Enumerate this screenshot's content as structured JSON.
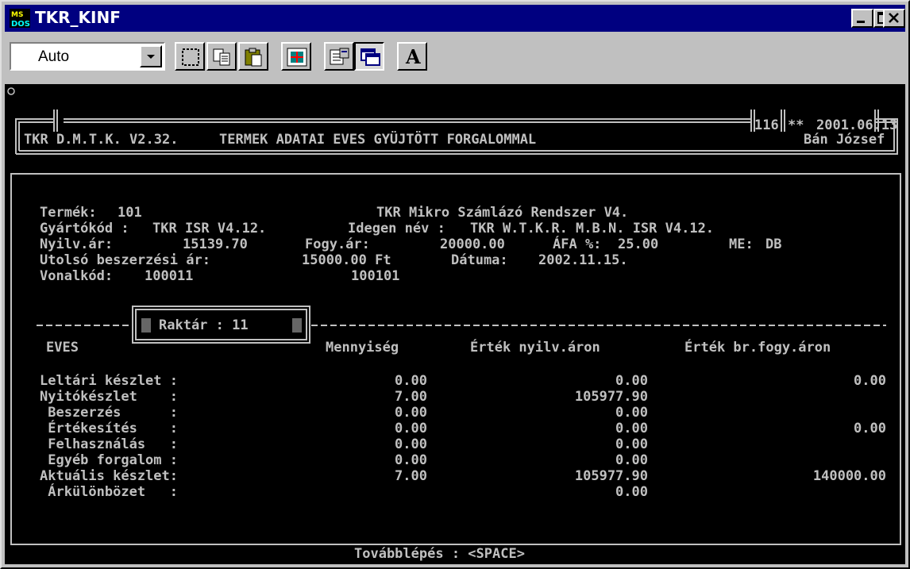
{
  "window": {
    "title": "TKR_KINF",
    "app_icon": "ms-dos-icon",
    "controls": [
      "minimize",
      "maximize",
      "close"
    ]
  },
  "toolbar": {
    "font_size_value": "Auto",
    "tools": [
      "mark-icon",
      "copy-icon",
      "paste-icon",
      "fullscreen-icon",
      "properties-icon",
      "background-icon",
      "font-icon"
    ],
    "font_button_label": "A"
  },
  "header": {
    "program": "TKR D.M.T.K. V2.32.",
    "screen_title": "TERMEK ADATAI EVES GYÜJTÖTT FORGALOMMAL",
    "code": "116",
    "flag": "**",
    "date": "2001.06.13",
    "user": "Bán József"
  },
  "product": {
    "termek_label": "Termék:",
    "termek_value": "101",
    "name": "TKR Mikro Számlázó Rendszer V4.",
    "gyartokod_label": "Gyártókód :",
    "gyartokod_value": "TKR ISR V4.12.",
    "idegen_label": "Idegen név :",
    "idegen_value": "TKR W.T.K.R. M.B.N. ISR V4.12.",
    "nyilvar_label": "Nyilv.ár:",
    "nyilvar_value": "15139.70",
    "fogyar_label": "Fogy.ár:",
    "fogyar_value": "20000.00",
    "afa_label": "ÁFA %:",
    "afa_value": "25.00",
    "me_label": "ME:",
    "me_value": "DB",
    "utolso_label": "Utolsó beszerzési ár:",
    "utolso_value": "15000.00 Ft",
    "datuma_label": "Dátuma:",
    "datuma_value": "2002.11.15.",
    "vonalkod_label": "Vonalkód:",
    "vonalkod_value": "100011",
    "vonalkod_value2": "100101"
  },
  "raktar": {
    "label": "Raktár : 11"
  },
  "table": {
    "headers": [
      "EVES",
      "Mennyiség",
      "Érték nyilv.áron",
      "Érték br.fogy.áron"
    ],
    "rows": [
      {
        "label": "Leltári készlet :",
        "qty": "0.00",
        "value": "0.00",
        "gross": "0.00"
      },
      {
        "label": "Nyitókészlet    :",
        "qty": "7.00",
        "value": "105977.90",
        "gross": ""
      },
      {
        "label": " Beszerzés      :",
        "qty": "0.00",
        "value": "0.00",
        "gross": ""
      },
      {
        "label": " Értékesítés    :",
        "qty": "0.00",
        "value": "0.00",
        "gross": "0.00"
      },
      {
        "label": " Felhasználás   :",
        "qty": "0.00",
        "value": "0.00",
        "gross": ""
      },
      {
        "label": " Egyéb forgalom :",
        "qty": "0.00",
        "value": "0.00",
        "gross": ""
      },
      {
        "label": "Aktuális készlet:",
        "qty": "7.00",
        "value": "105977.90",
        "gross": "140000.00"
      },
      {
        "label": " Árkülönbözet   :",
        "qty": "",
        "value": "0.00",
        "gross": ""
      }
    ]
  },
  "footer": {
    "hint": "Továbblépés : <SPACE>"
  }
}
